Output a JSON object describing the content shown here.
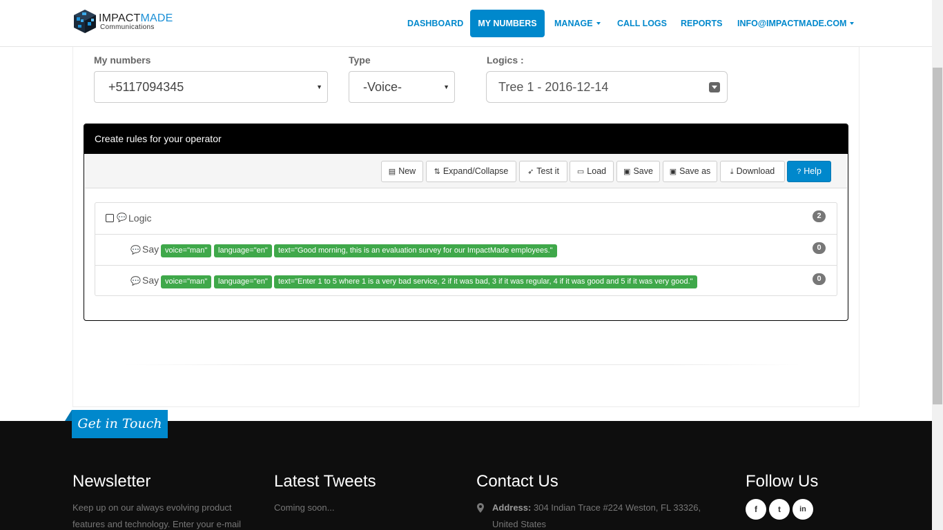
{
  "navbar": {
    "logo": {
      "text_primary": "IMPACT",
      "text_accent": "MADE",
      "subtitle": "Communications"
    },
    "items": [
      {
        "label": "DASHBOARD",
        "active": false
      },
      {
        "label": "MY NUMBERS",
        "active": true
      },
      {
        "label": "MANAGE",
        "active": false,
        "dropdown": true
      },
      {
        "label": "CALL LOGS",
        "active": false
      },
      {
        "label": "REPORTS",
        "active": false
      },
      {
        "label": "INFO@IMPACTMADE.COM",
        "active": false,
        "dropdown": true
      }
    ],
    "accent_color": "#0088cc"
  },
  "filters": {
    "my_numbers": {
      "label": "My numbers",
      "value": "+5117094345"
    },
    "type": {
      "label": "Type",
      "value": "-Voice-"
    },
    "logics": {
      "label": "Logics :",
      "value": "Tree 1 - 2016-12-14"
    }
  },
  "panel": {
    "title": "Create rules for your operator",
    "toolbar": [
      {
        "label": "New",
        "icon": "file-icon"
      },
      {
        "label": "Expand/Collapse",
        "icon": "sort-icon"
      },
      {
        "label": "Test it",
        "icon": "rocket-icon"
      },
      {
        "label": "Load",
        "icon": "folder-open-icon"
      },
      {
        "label": "Save",
        "icon": "floppy-icon"
      },
      {
        "label": "Save as",
        "icon": "floppy-icon"
      },
      {
        "label": "Download",
        "icon": "download-icon"
      },
      {
        "label": "Help",
        "icon": "question-circle-icon",
        "primary": true
      }
    ],
    "tree": {
      "root": {
        "label": "Logic",
        "count": "2"
      },
      "children": [
        {
          "label": "Say",
          "count": "0",
          "tags": [
            "voice=\"man\"",
            "language=\"en\"",
            "text=\"Good morning, this is an evaluation survey for our ImpactMade employees.\""
          ]
        },
        {
          "label": "Say",
          "count": "0",
          "tags": [
            "voice=\"man\"",
            "language=\"en\"",
            "text=\"Enter 1 to 5 where 1 is a very bad service, 2 if it was bad, 3 if it was regular, 4 if it was good and 5 if it was very good.\""
          ]
        }
      ]
    },
    "tag_color": "#3fa84a"
  },
  "footer": {
    "ribbon": "Get in Touch",
    "newsletter": {
      "title": "Newsletter",
      "text_line1": "Keep up on our always evolving product",
      "text_line2": "features and technology. Enter your e-mail"
    },
    "tweets": {
      "title": "Latest Tweets",
      "text": "Coming soon..."
    },
    "contact": {
      "title": "Contact Us",
      "address_label": "Address:",
      "address_line1": "304 Indian Trace #224 Weston, FL 33326,",
      "address_line2": "United States"
    },
    "follow": {
      "title": "Follow Us",
      "icons": [
        "facebook-icon",
        "twitter-icon",
        "linkedin-icon"
      ],
      "glyphs": [
        "f",
        "t",
        "in"
      ]
    }
  }
}
